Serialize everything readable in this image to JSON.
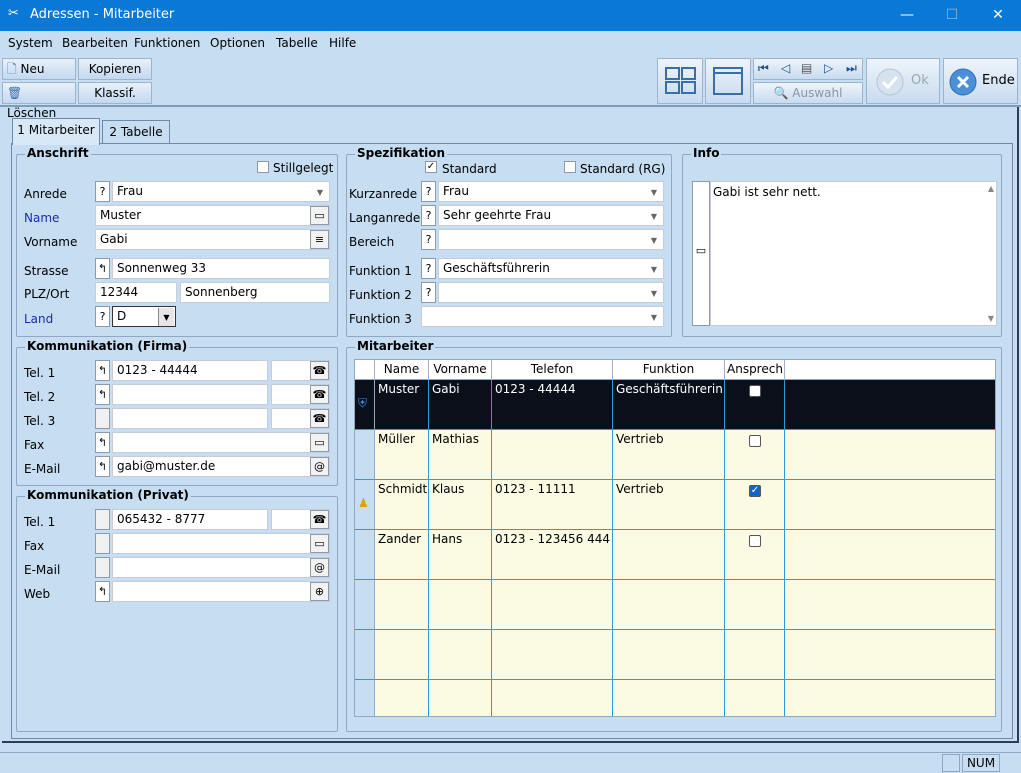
{
  "window": {
    "title": "Adressen - Mitarbeiter"
  },
  "menu": [
    "System",
    "Bearbeiten",
    "Funktionen",
    "Optionen",
    "Tabelle",
    "Hilfe"
  ],
  "toolbar": {
    "neu": "Neu",
    "loeschen": "Löschen",
    "kopieren": "Kopieren",
    "klassif": "Klassif.",
    "auswahl": "Auswahl",
    "ok": "Ok",
    "ende": "Ende"
  },
  "tabs": [
    "1 Mitarbeiter",
    "2 Tabelle"
  ],
  "anschrift": {
    "title": "Anschrift",
    "stillgelegt": "Stillgelegt",
    "anrede_label": "Anrede",
    "anrede": "Frau",
    "name_label": "Name",
    "name": "Muster",
    "vorname_label": "Vorname",
    "vorname": "Gabi",
    "strasse_label": "Strasse",
    "strasse": "Sonnenweg 33",
    "plz_label": "PLZ/Ort",
    "plz": "12344",
    "ort": "Sonnenberg",
    "land_label": "Land",
    "land": "D"
  },
  "komm_firma": {
    "title": "Kommunikation (Firma)",
    "tel1_label": "Tel. 1",
    "tel1": "0123 - 44444",
    "tel2_label": "Tel. 2",
    "tel3_label": "Tel. 3",
    "fax_label": "Fax",
    "email_label": "E-Mail",
    "email": "gabi@muster.de"
  },
  "komm_privat": {
    "title": "Kommunikation (Privat)",
    "tel1_label": "Tel. 1",
    "tel1": "065432 - 8777",
    "fax_label": "Fax",
    "email_label": "E-Mail",
    "web_label": "Web"
  },
  "spezifikation": {
    "title": "Spezifikation",
    "standard": "Standard",
    "standard_rg": "Standard (RG)",
    "kurzanrede_label": "Kurzanrede",
    "kurzanrede": "Frau",
    "langanrede_label": "Langanrede",
    "langanrede": "Sehr geehrte Frau",
    "bereich_label": "Bereich",
    "funktion1_label": "Funktion 1",
    "funktion1": "Geschäftsführerin",
    "funktion2_label": "Funktion 2",
    "funktion3_label": "Funktion 3"
  },
  "info": {
    "title": "Info",
    "text": "Gabi ist sehr nett."
  },
  "mitarbeiter": {
    "title": "Mitarbeiter",
    "columns": [
      "Name",
      "Vorname",
      "Telefon",
      "Funktion",
      "Ansprechp"
    ],
    "rows": [
      {
        "name": "Muster",
        "vorname": "Gabi",
        "telefon": "0123 - 44444",
        "funktion": "Geschäftsführerin",
        "ansprechp": false
      },
      {
        "name": "Müller",
        "vorname": "Mathias",
        "telefon": "",
        "funktion": "Vertrieb",
        "ansprechp": false
      },
      {
        "name": "Schmidt",
        "vorname": "Klaus",
        "telefon": "0123 - 11111",
        "funktion": "Vertrieb",
        "ansprechp": true
      },
      {
        "name": "Zander",
        "vorname": "Hans",
        "telefon": "0123 - 123456 444",
        "funktion": "",
        "ansprechp": false
      }
    ]
  },
  "status": {
    "num": "NUM"
  }
}
